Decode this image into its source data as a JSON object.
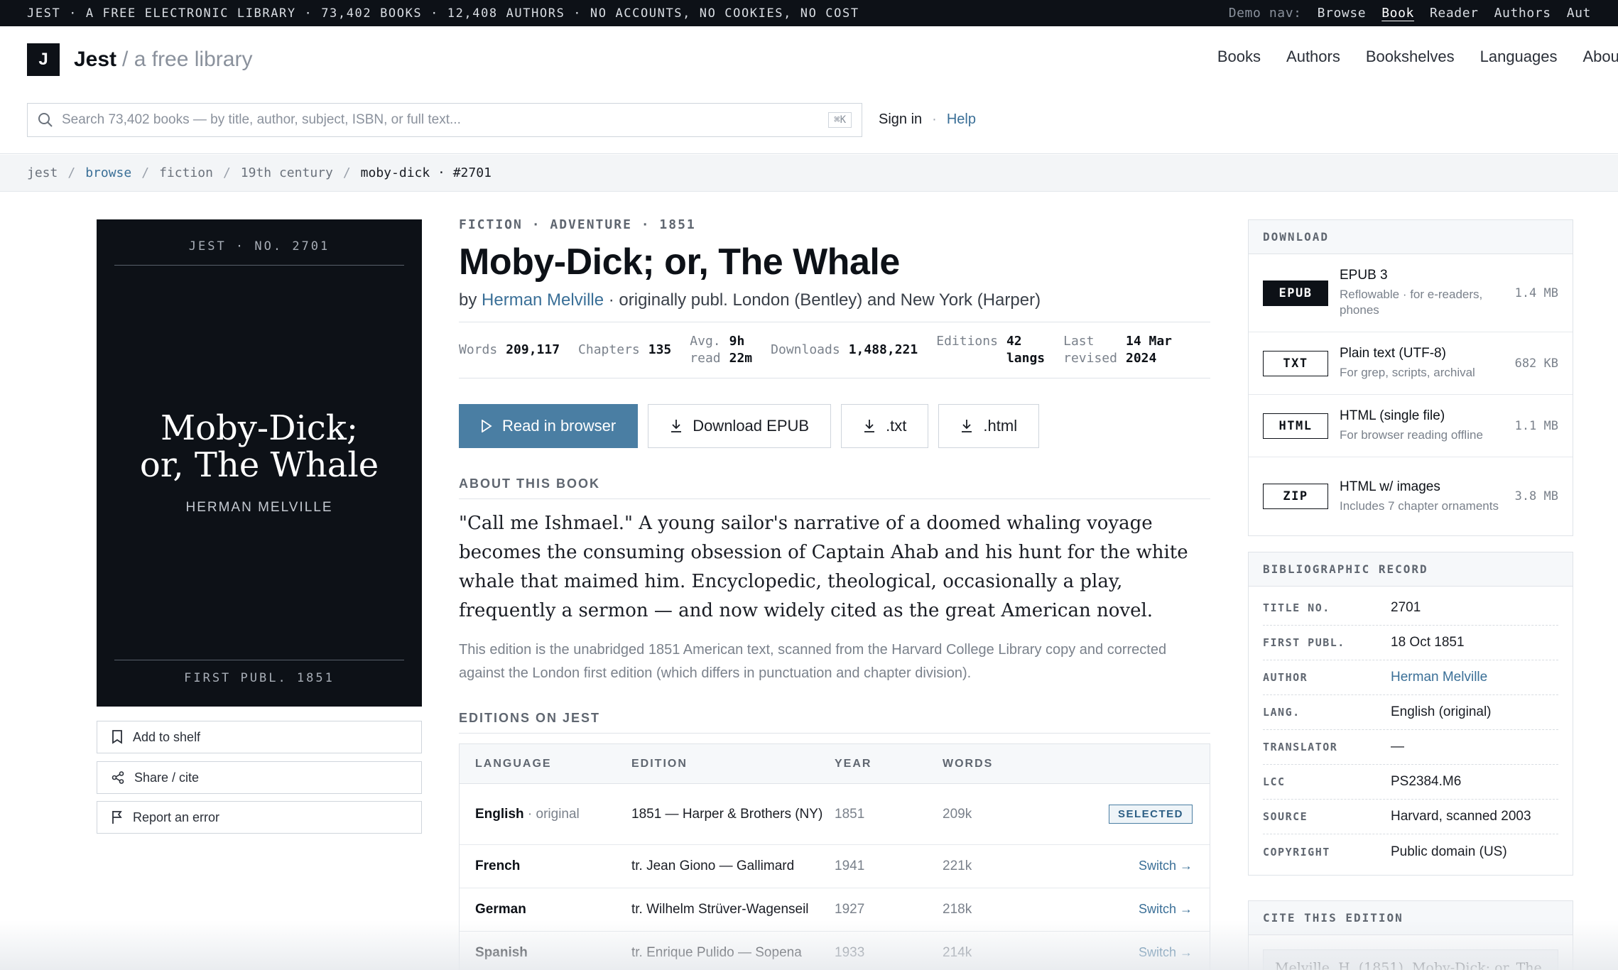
{
  "topstrip": {
    "text": "JEST · A FREE ELECTRONIC LIBRARY · 73,402 BOOKS · 12,408 AUTHORS · NO ACCOUNTS, NO COOKIES, NO COST",
    "demo_label": "Demo nav:",
    "demo_items": [
      "Browse",
      "Book",
      "Reader",
      "Authors",
      "Aut"
    ],
    "active": "Book"
  },
  "header": {
    "logo": "J",
    "brand": "Jest",
    "tagline": "/ a free library",
    "nav": [
      "Books",
      "Authors",
      "Bookshelves",
      "Languages",
      "About"
    ],
    "search_placeholder": "Search 73,402 books — by title, author, subject, ISBN, or full text...",
    "search_kbd": "⌘K",
    "signin": "Sign in",
    "sep": "·",
    "help": "Help"
  },
  "breadcrumb": {
    "items": [
      "jest",
      "browse",
      "fiction",
      "19th century",
      "moby-dick · #2701"
    ],
    "sep": "/"
  },
  "cover": {
    "top": "JEST · NO. 2701",
    "title_line1": "Moby-Dick;",
    "title_line2": "or, The Whale",
    "author": "HERMAN MELVILLE",
    "bottom": "FIRST PUBL. 1851"
  },
  "side_actions": [
    "Add to shelf",
    "Share / cite",
    "Report an error"
  ],
  "book": {
    "kicker": "FICTION · ADVENTURE · 1851",
    "title": "Moby-Dick; or, The Whale",
    "by": "by",
    "author": "Herman Melville",
    "origin": "· originally publ. London (Bentley) and New York (Harper)",
    "stats": [
      {
        "k": "Words",
        "v": "209,117"
      },
      {
        "k": "Chapters",
        "v": "135"
      },
      {
        "k": "Avg. read",
        "k1": "Avg.",
        "k2": "read",
        "v1": "9h",
        "v2": "22m"
      },
      {
        "k": "Downloads",
        "v": "1,488,221"
      },
      {
        "k": "Editions",
        "v1": "42",
        "v2": "langs"
      },
      {
        "k1": "Last",
        "k2": "revised",
        "v1": "14 Mar",
        "v2": "2024"
      }
    ],
    "actions": {
      "read": "Read in browser",
      "epub": "Download EPUB",
      "txt": ".txt",
      "html": ".html"
    },
    "about_heading": "ABOUT THIS BOOK",
    "description": "\"Call me Ishmael.\" A young sailor's narrative of a doomed whaling voyage becomes the consuming obsession of Captain Ahab and his hunt for the white whale that maimed him. Encyclopedic, theological, occasionally a play, frequently a sermon — and now widely cited as the great American novel.",
    "note": "This edition is the unabridged 1851 American text, scanned from the Harvard College Library copy and corrected against the London first edition (which differs in punctuation and chapter division)."
  },
  "editions": {
    "heading": "EDITIONS ON JEST",
    "columns": [
      "LANGUAGE",
      "EDITION",
      "YEAR",
      "WORDS"
    ],
    "rows": [
      {
        "lang": "English",
        "extra": "· original",
        "edition": "1851 — Harper & Brothers (NY)",
        "year": "1851",
        "words": "209k",
        "action": "SELECTED"
      },
      {
        "lang": "French",
        "extra": "",
        "edition": "tr. Jean Giono — Gallimard",
        "year": "1941",
        "words": "221k",
        "action": "Switch →"
      },
      {
        "lang": "German",
        "extra": "",
        "edition": "tr. Wilhelm Strüver-Wagenseil",
        "year": "1927",
        "words": "218k",
        "action": "Switch →"
      },
      {
        "lang": "Spanish",
        "extra": "",
        "edition": "tr. Enrique Pulido — Sopena",
        "year": "1933",
        "words": "214k",
        "action": "Switch →"
      }
    ]
  },
  "download": {
    "heading": "DOWNLOAD",
    "items": [
      {
        "fmt": "EPUB",
        "name": "EPUB 3",
        "sub": "Reflowable · for e-readers, phones",
        "size": "1.4 MB"
      },
      {
        "fmt": "TXT",
        "name": "Plain text (UTF-8)",
        "sub": "For grep, scripts, archival",
        "size": "682 KB"
      },
      {
        "fmt": "HTML",
        "name": "HTML (single file)",
        "sub": "For browser reading offline",
        "size": "1.1 MB"
      },
      {
        "fmt": "ZIP",
        "name": "HTML w/ images",
        "sub": "Includes 7 chapter ornaments",
        "size": "3.8 MB"
      }
    ]
  },
  "biblio": {
    "heading": "BIBLIOGRAPHIC RECORD",
    "rows": [
      {
        "k": "TITLE NO.",
        "v": "2701"
      },
      {
        "k": "FIRST PUBL.",
        "v": "18 Oct 1851"
      },
      {
        "k": "AUTHOR",
        "v": "Herman Melville"
      },
      {
        "k": "LANG.",
        "v": "English (original)"
      },
      {
        "k": "TRANSLATOR",
        "v": "—"
      },
      {
        "k": "LCC",
        "v": "PS2384.M6"
      },
      {
        "k": "SOURCE",
        "v": "Harvard, scanned 2003"
      },
      {
        "k": "COPYRIGHT",
        "v": "Public domain (US)"
      }
    ]
  },
  "cite": {
    "heading": "CITE THIS EDITION",
    "text": "Melville, H. (1851). Moby-Dick; or, The"
  },
  "colors": {
    "accent": "#4a7ea3",
    "ink": "#0d1117",
    "link": "#3a6f97"
  }
}
